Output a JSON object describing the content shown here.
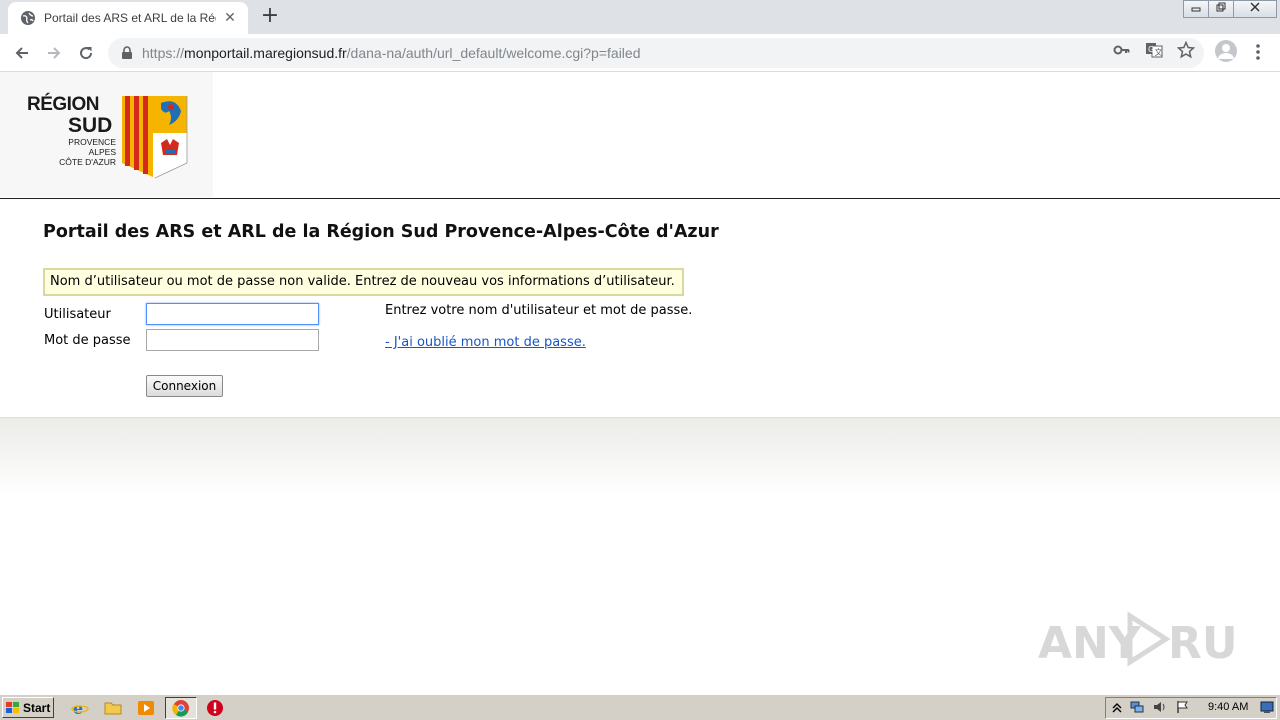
{
  "browser": {
    "tab_title": "Portail des ARS et ARL de la Région Sud Provence-Alpes-Côte d'Azur",
    "new_tab": "+",
    "close_tab": "✕",
    "url_scheme": "https://",
    "url_host": "monportail.maregionsud.fr",
    "url_path": "/dana-na/auth/url_default/welcome.cgi?p=failed"
  },
  "logo": {
    "line1": "RÉGION",
    "line2": "SUD",
    "line3": "PROVENCE",
    "line4": "ALPES",
    "line5": "CÔTE D'AZUR"
  },
  "page": {
    "title": "Portail des ARS et ARL de la Région Sud Provence-Alpes-Côte d'Azur",
    "error_message": "Nom d’utilisateur ou mot de passe non valide. Entrez de nouveau vos informations d’utilisateur.",
    "username_label": "Utilisateur",
    "password_label": "Mot de passe",
    "username_value": "",
    "password_value": "",
    "help_text": "Entrez votre nom d'utilisateur et mot de passe.",
    "forgot_link": "- J'ai oublié mon mot de passe.",
    "submit_label": "Connexion"
  },
  "watermark": "ANY RUN",
  "taskbar": {
    "start_label": "Start",
    "clock": "9:40 AM"
  },
  "colors": {
    "error_bg": "#ffffe0",
    "link": "#1a55c8",
    "focus_border": "#4d90fe"
  }
}
